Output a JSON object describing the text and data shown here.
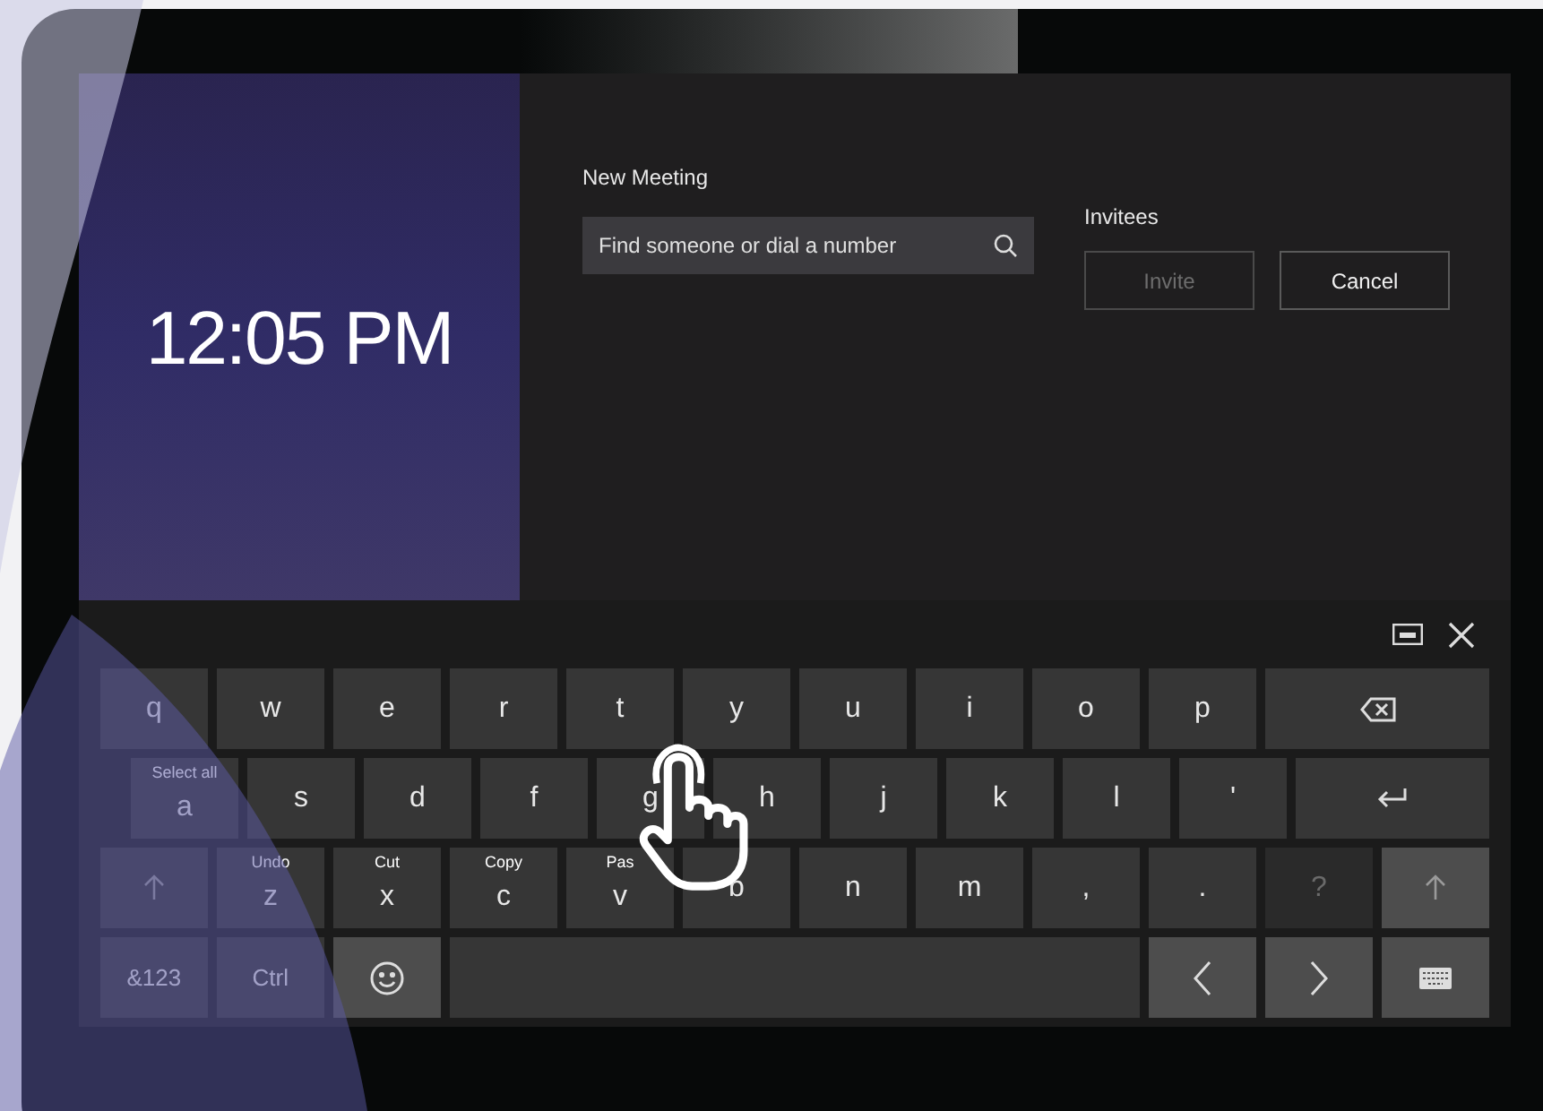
{
  "clock": {
    "time": "12:05 PM"
  },
  "meeting": {
    "title": "New Meeting",
    "search": {
      "placeholder": "Find someone or dial a number"
    },
    "invitees_label": "Invitees",
    "buttons": [
      {
        "label": "Invite",
        "disabled": true
      },
      {
        "label": "Cancel",
        "disabled": false
      }
    ]
  },
  "keyboard": {
    "rows": [
      [
        {
          "kind": "letter",
          "label": "q",
          "disabled": false
        },
        {
          "kind": "letter",
          "label": "w",
          "disabled": false
        },
        {
          "kind": "letter",
          "label": "e",
          "disabled": false
        },
        {
          "kind": "letter",
          "label": "r",
          "disabled": false
        },
        {
          "kind": "letter",
          "label": "t",
          "disabled": false
        },
        {
          "kind": "letter",
          "label": "y",
          "disabled": false
        },
        {
          "kind": "letter",
          "label": "u",
          "disabled": false
        },
        {
          "kind": "letter",
          "label": "i",
          "disabled": false
        },
        {
          "kind": "letter",
          "label": "o",
          "disabled": false
        },
        {
          "kind": "letter",
          "label": "p",
          "disabled": false
        },
        {
          "kind": "backspace",
          "disabled": false
        }
      ],
      [
        {
          "kind": "letter",
          "label": "a",
          "hint": "Select all",
          "disabled": false
        },
        {
          "kind": "letter",
          "label": "s",
          "disabled": false
        },
        {
          "kind": "letter",
          "label": "d",
          "disabled": false
        },
        {
          "kind": "letter",
          "label": "f",
          "disabled": false
        },
        {
          "kind": "letter",
          "label": "g",
          "disabled": false
        },
        {
          "kind": "letter",
          "label": "h",
          "disabled": false
        },
        {
          "kind": "letter",
          "label": "j",
          "disabled": false
        },
        {
          "kind": "letter",
          "label": "k",
          "disabled": false
        },
        {
          "kind": "letter",
          "label": "l",
          "disabled": false
        },
        {
          "kind": "letter",
          "label": "'",
          "disabled": false
        },
        {
          "kind": "enter",
          "disabled": false
        }
      ],
      [
        {
          "kind": "shift",
          "disabled": false
        },
        {
          "kind": "letter",
          "label": "z",
          "hint": "Undo",
          "disabled": false
        },
        {
          "kind": "letter",
          "label": "x",
          "hint": "Cut",
          "disabled": false
        },
        {
          "kind": "letter",
          "label": "c",
          "hint": "Copy",
          "disabled": false
        },
        {
          "kind": "letter",
          "label": "v",
          "hint": "Pas",
          "disabled": false
        },
        {
          "kind": "letter",
          "label": "b",
          "disabled": false
        },
        {
          "kind": "letter",
          "label": "n",
          "disabled": false
        },
        {
          "kind": "letter",
          "label": "m",
          "disabled": false
        },
        {
          "kind": "letter",
          "label": ",",
          "disabled": false
        },
        {
          "kind": "letter",
          "label": ".",
          "disabled": false
        },
        {
          "kind": "letter",
          "label": "?",
          "disabled": true
        },
        {
          "kind": "shift_right",
          "disabled": false
        }
      ],
      [
        {
          "kind": "letter",
          "label": "&123",
          "disabled": false
        },
        {
          "kind": "letter",
          "label": "Ctrl",
          "disabled": false
        },
        {
          "kind": "emoji",
          "disabled": false
        },
        {
          "kind": "space",
          "disabled": false
        },
        {
          "kind": "left",
          "disabled": false
        },
        {
          "kind": "right",
          "disabled": false
        },
        {
          "kind": "layout",
          "disabled": false
        }
      ]
    ]
  }
}
